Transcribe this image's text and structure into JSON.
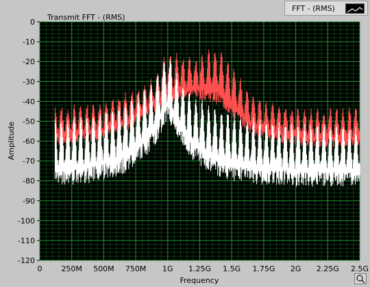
{
  "legend": {
    "label": "FFT - (RMS)"
  },
  "colors": {
    "background": "#000000",
    "grid_major": "#1f8f2f",
    "grid_minor": "#0b3c12",
    "series_transmit": "#ff4f4f",
    "series_base": "#ffffff"
  },
  "icons": {
    "corner": "magnify-icon"
  },
  "chart_data": {
    "type": "line",
    "title": "Transmit FFT - (RMS)",
    "xlabel": "Frequency",
    "ylabel": "Amplitude",
    "xlim": [
      0,
      2.5
    ],
    "ylim": [
      -120,
      0
    ],
    "x_ticks": [
      0,
      0.25,
      0.5,
      0.75,
      1.0,
      1.25,
      1.5,
      1.75,
      2.0,
      2.25,
      2.5
    ],
    "x_tick_labels": [
      "0",
      "250M",
      "500M",
      "750M",
      "1G",
      "1.25G",
      "1.5G",
      "1.75G",
      "2G",
      "2.25G",
      "2.5G"
    ],
    "y_ticks": [
      0,
      -10,
      -20,
      -30,
      -40,
      -50,
      -60,
      -70,
      -80,
      -90,
      -100,
      -110,
      -120
    ],
    "y_tick_labels": [
      "0",
      "-10",
      "-20",
      "-30",
      "-40",
      "-50",
      "-60",
      "-70",
      "-80",
      "-90",
      "-100",
      "-110",
      "-120"
    ],
    "grid": true,
    "series": [
      {
        "color": "#ff4f4f",
        "peak_x": [
          0.12,
          0.2,
          0.3,
          0.4,
          0.5,
          0.6,
          0.7,
          0.8,
          0.9,
          1.0,
          1.1,
          1.2,
          1.3,
          1.4,
          1.5,
          1.6,
          1.7,
          1.8,
          1.9,
          2.0,
          2.1,
          2.2,
          2.3,
          2.4,
          2.5
        ],
        "peak_y": [
          -43,
          -44,
          -43,
          -42,
          -41,
          -39,
          -36,
          -33,
          -29,
          -15,
          -18,
          -20,
          -16,
          -15,
          -22,
          -34,
          -39,
          -42,
          -43,
          -44,
          -45,
          -45,
          -45,
          -45,
          -44
        ],
        "floor_y": [
          -62,
          -62,
          -61,
          -60,
          -59,
          -57,
          -54,
          -50,
          -45,
          -42,
          -40,
          -38,
          -40,
          -42,
          -48,
          -54,
          -58,
          -60,
          -61,
          -62,
          -63,
          -63,
          -63,
          -63,
          -63
        ]
      },
      {
        "color": "#ffffff",
        "peak_x": [
          0.12,
          0.2,
          0.3,
          0.4,
          0.5,
          0.6,
          0.7,
          0.8,
          0.9,
          1.0,
          1.1,
          1.2,
          1.3,
          1.4,
          1.5,
          1.6,
          1.7,
          1.8,
          1.9,
          2.0,
          2.1,
          2.2,
          2.3,
          2.4,
          2.5
        ],
        "peak_y": [
          -50,
          -50,
          -49,
          -47,
          -46,
          -44,
          -40,
          -36,
          -30,
          -17,
          -30,
          -38,
          -42,
          -45,
          -47,
          -49,
          -50,
          -51,
          -51,
          -52,
          -52,
          -52,
          -53,
          -53,
          -55
        ],
        "floor_y": [
          -83,
          -83,
          -82,
          -81,
          -80,
          -78,
          -75,
          -70,
          -62,
          -50,
          -62,
          -70,
          -75,
          -78,
          -80,
          -81,
          -82,
          -82,
          -82,
          -83,
          -83,
          -83,
          -83,
          -83,
          -82
        ]
      }
    ]
  }
}
